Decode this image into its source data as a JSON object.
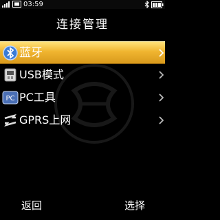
{
  "status_bar": {
    "time": "03:59",
    "icons": [
      "signal-icon",
      "phone-icon",
      "bluetooth-icon",
      "battery-icon"
    ]
  },
  "title": "连接管理",
  "menu": {
    "items": [
      {
        "label": "蓝牙",
        "icon": "bluetooth-icon",
        "selected": true
      },
      {
        "label": "USB模式",
        "icon": "usb-icon",
        "selected": false
      },
      {
        "label": "PC工具",
        "icon": "pc-tools-icon",
        "selected": false
      },
      {
        "label": "GPRS上网",
        "icon": "gprs-icon",
        "selected": false
      }
    ]
  },
  "softkeys": {
    "left": "返回",
    "right": "选择"
  },
  "colors": {
    "selection": "#f0b530",
    "background": "#000000",
    "status_bar": "#0a0a0a"
  }
}
